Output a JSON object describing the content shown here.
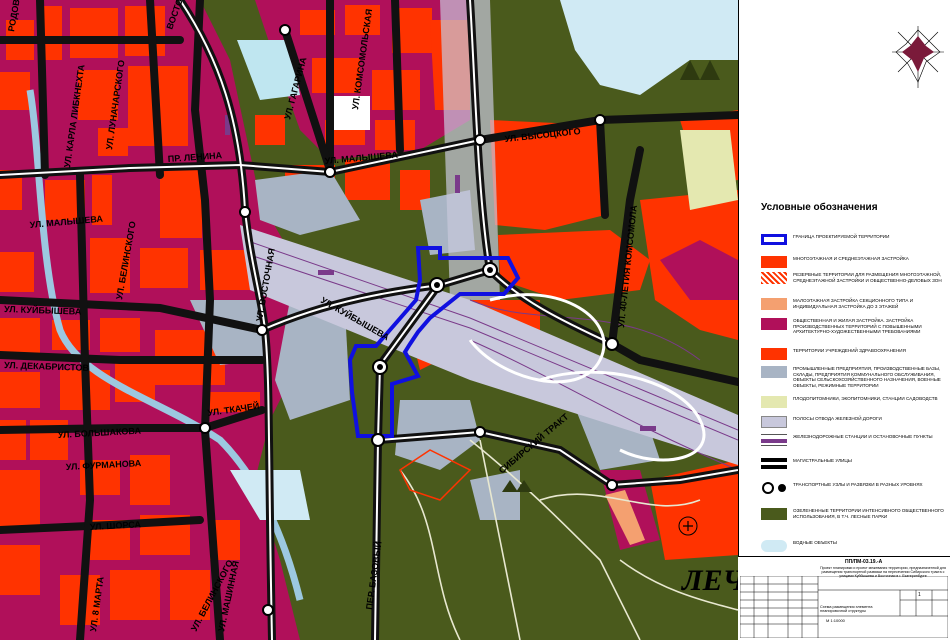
{
  "map": {
    "streets": [
      "РОДОВА",
      "ВОСТОЧНАЯ",
      "УЛ. ГАГАРИНА",
      "УЛ. КОМСОМОЛЬСКАЯ",
      "УЛ. ЛУНАЧАРСКОГО",
      "УЛ. КАРЛА ЛИБКНЕХТА",
      "ПР. ЛЕНИНА",
      "УЛ. МАЛЫШЕВА",
      "УЛ. ВЫСОЦКОГО",
      "УЛ. МАЛЫШЕВА",
      "УЛ. БЕЛИНСКОГО",
      "УЛ. КУЙБЫШЕВА",
      "УЛ. ВОСТОЧНАЯ",
      "УЛ. КУЙБЫШЕВА",
      "УЛ. 40-ЛЕТИЯ КОМСОМОЛА",
      "УЛ. ДЕКАБРИСТОВ",
      "УЛ. БОЛЬШАКОВА",
      "УЛ. ТКАЧЕЙ",
      "УЛ. ФУРМАНОВА",
      "СИБИРСКИЙ ТРАКТ",
      "УЛ. ШОРСА",
      "ПЕР. БАЗОВЫЙ",
      "УЛ. 8 МАРТА",
      "УЛ. БЕЛИНСКОГО",
      "УЛ. МАШИННАЯ"
    ],
    "park_label": "ЛЕЧ"
  },
  "legend": {
    "title": "Условные обозначения",
    "items": [
      {
        "text": "ГРАНИЦА ПРОЕКТИРУЕМОЙ ТЕРРИТОРИИ",
        "color": "#1010e0",
        "kind": "outline"
      },
      {
        "text": "МНОГОЭТАЖНАЯ И СРЕДНЕЭТАЖНАЯ ЗАСТРОЙКА",
        "color": "#ff3300",
        "kind": "fill"
      },
      {
        "text": "РЕЗЕРВНЫЕ ТЕРРИТОРИИ ДЛЯ РАЗМЕЩЕНИЯ МНОГОЭТАЖНОЙ, СРЕДНЕЭТАЖНОЙ ЗАСТРОЙКИ И ОБЩЕСТВЕННО-ДЕЛОВЫХ ЗОН",
        "color": "#ff3300",
        "kind": "hatch"
      },
      {
        "text": "МАЛОЭТАЖНАЯ ЗАСТРОЙКА СЕКЦИОННОГО ТИПА И ИНДИВИДУАЛЬНАЯ ЗАСТРОЙКА ДО 3 ЭТАЖЕЙ",
        "color": "#f4a070",
        "kind": "fill"
      },
      {
        "text": "ОБЩЕСТВЕННАЯ И ЖИЛАЯ ЗАСТРОЙКА. ЗАСТРОЙКА ПРОИЗВОДСТВЕННЫХ ТЕРРИТОРИЙ С ПОВЫШЕННЫМИ АРХИТЕКТУРНО-ХУДОЖЕСТВЕННЫМИ ТРЕБОВАНИЯМИ",
        "color": "#b0105a",
        "kind": "fill"
      },
      {
        "text": "ТЕРРИТОРИИ УЧРЕЖДЕНИЙ ЗДРАВООХРАНЕНИЯ",
        "color": "#ff3300",
        "kind": "cross"
      },
      {
        "text": "ПРОМЫШЛЕННЫЕ ПРЕДПРИЯТИЯ, ПРОИЗВОДСТВЕННЫЕ БАЗЫ, СКЛАДЫ, ПРЕДПРИЯТИЯ КОММУНАЛЬНОГО ОБСЛУЖИВАНИЯ, ОБЪЕКТЫ СЕЛЬСКОХОЗЯЙСТВЕННОГО НАЗНАЧЕНИЯ, ВОЕННЫЕ ОБЪЕКТЫ, РЕЖИМНЫЕ ТЕРРИТОРИИ",
        "color": "#a8b4c4",
        "kind": "fill"
      },
      {
        "text": "ПЛОДОПИТОМНИКИ, ЭКОПИТОМНИКИ, СТАНЦИИ САДОВОДСТВ",
        "color": "#e4e8b0",
        "kind": "fill"
      },
      {
        "text": "ПОЛОСЫ ОТВОДА ЖЕЛЕЗНОЙ ДОРОГИ",
        "color": "#c8c8dc",
        "kind": "fill"
      },
      {
        "text": "ЖЕЛЕЗНОДОРОЖНЫЕ СТАНЦИИ И ОСТАНОВОЧНЫЕ ПУНКТЫ",
        "color": "#7a3a8a",
        "kind": "rail"
      },
      {
        "text": "МАГИСТРАЛЬНЫЕ УЛИЦЫ",
        "color": "#000000",
        "kind": "road"
      },
      {
        "text": "ТРАНСПОРТНЫЕ УЗЛЫ И РАЗВЯЗКИ В РАЗНЫХ УРОВНЯХ",
        "color": "#000000",
        "kind": "node"
      },
      {
        "text": "ОЗЕЛЕНЕННЫЕ ТЕРРИТОРИИ ИНТЕНСИВНОГО ОБЩЕСТВЕННОГО ИСПОЛЬЗОВАНИЯ, В Т.Ч. ЛЕСНЫЕ ПАРКИ",
        "color": "#4a5a1c",
        "kind": "fill"
      },
      {
        "text": "ВОДНЫЕ ОБЪЕКТЫ",
        "color": "#d0eaf4",
        "kind": "fill"
      }
    ]
  },
  "stamp": {
    "code": "ПП/ПМ-03.19.-А",
    "text": "Проект планировки и проект межевания территории, предназначенной для размещения транспортной развязки на пересечении Сибирского тракта с улицами Куйбышева и Восточная в г. Екатеринбурге",
    "subtitle": "Схема размещения элемента планировочной структуры",
    "scale": "М 1:10000",
    "sheet": "1"
  }
}
